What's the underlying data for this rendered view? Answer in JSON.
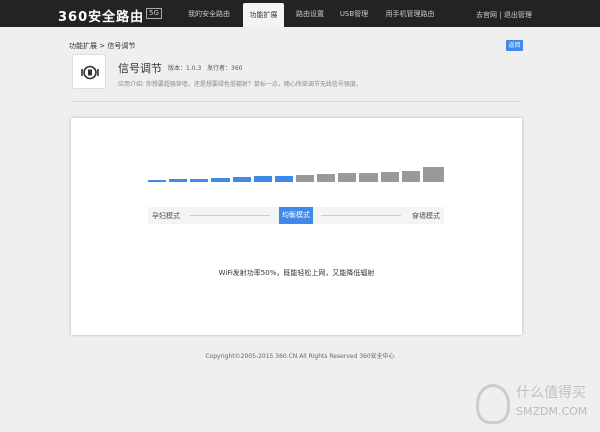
{
  "header": {
    "logo": "360安全路由",
    "badge": "5G",
    "nav": [
      {
        "label": "我的安全路由",
        "active": false
      },
      {
        "label": "功能扩展",
        "active": true
      },
      {
        "label": "路由设置",
        "active": false
      },
      {
        "label": "USB管理",
        "active": false
      },
      {
        "label": "用手机管理路由",
        "active": false
      }
    ],
    "links": {
      "official": "去官网",
      "sep": "|",
      "logout": "退出管理"
    }
  },
  "breadcrumb": "功能扩展 > 信号调节",
  "back_label": "返回",
  "app": {
    "icon": "signal-adjust-icon",
    "title": "信号调节",
    "version": "版本：1.0.3",
    "publisher": "发行者：360",
    "desc": "应用介绍: 你想要超强穿墙，还是想要绿色低辐射？鼠标一点，随心所欲调节无线信号强度。"
  },
  "signal": {
    "segments": 14,
    "active_segments": 7,
    "active_color": "#3f8ae8",
    "inactive_color": "#999999",
    "power_percent": 50
  },
  "slider": {
    "left": "孕妇模式",
    "center": "均衡模式",
    "right": "穿墙模式"
  },
  "info": "WiFi发射功率50%，既能轻松上网，又能降低辐射",
  "footer": "Copyright©2005-2015 360.CN All Rights Reserved 360安全中心",
  "watermark": {
    "line1": "什么值得买",
    "line2": "SMZDM.COM"
  }
}
